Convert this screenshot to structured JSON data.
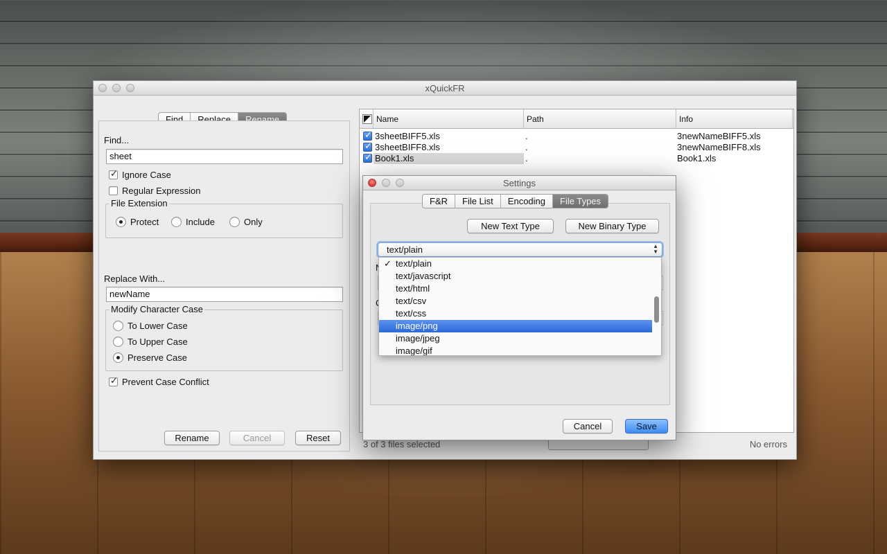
{
  "window": {
    "title": "xQuickFR"
  },
  "left": {
    "tabs": [
      "Find",
      "Replace",
      "Rename"
    ],
    "selected_tab": "Rename",
    "find_label": "Find...",
    "find_value": "sheet",
    "ignore_case": "Ignore Case",
    "regular_expression": "Regular Expression",
    "file_extension": {
      "title": "File Extension",
      "options": [
        "Protect",
        "Include",
        "Only"
      ],
      "selected": "Protect"
    },
    "replace_label": "Replace With...",
    "replace_value": "newName",
    "case_group": {
      "title": "Modify Character Case",
      "options": [
        "To Lower Case",
        "To Upper Case",
        "Preserve Case"
      ],
      "selected": "Preserve Case"
    },
    "prevent_conflict": "Prevent Case Conflict",
    "buttons": {
      "rename": "Rename",
      "cancel": "Cancel",
      "reset": "Reset"
    }
  },
  "table": {
    "columns": [
      "Name",
      "Path",
      "Info"
    ],
    "rows": [
      {
        "name": "3sheetBIFF5.xls",
        "path": ".",
        "info": "3newNameBIFF5.xls"
      },
      {
        "name": "3sheetBIFF8.xls",
        "path": ".",
        "info": "3newNameBIFF8.xls"
      },
      {
        "name": "Book1.xls",
        "path": ".",
        "info": "Book1.xls"
      }
    ]
  },
  "status": {
    "selected": "3 of 3 files selected",
    "errors": "No errors"
  },
  "dialog": {
    "title": "Settings",
    "tabs": [
      "F&R",
      "File List",
      "Encoding",
      "File Types"
    ],
    "selected_tab": "File Types",
    "new_text_type": "New Text Type",
    "new_binary_type": "New Binary Type",
    "combo_value": "text/plain",
    "popup_items": [
      "text/plain",
      "text/javascript",
      "text/html",
      "text/csv",
      "text/css",
      "image/png",
      "image/jpeg",
      "image/gif"
    ],
    "checked_item": "text/plain",
    "highlighted_item": "image/png",
    "peek_letters": [
      "N",
      "C"
    ],
    "cancel": "Cancel",
    "save": "Save"
  },
  "colors": {
    "accent": "#2c68d8",
    "selected_tab": "#7a7a7a"
  }
}
